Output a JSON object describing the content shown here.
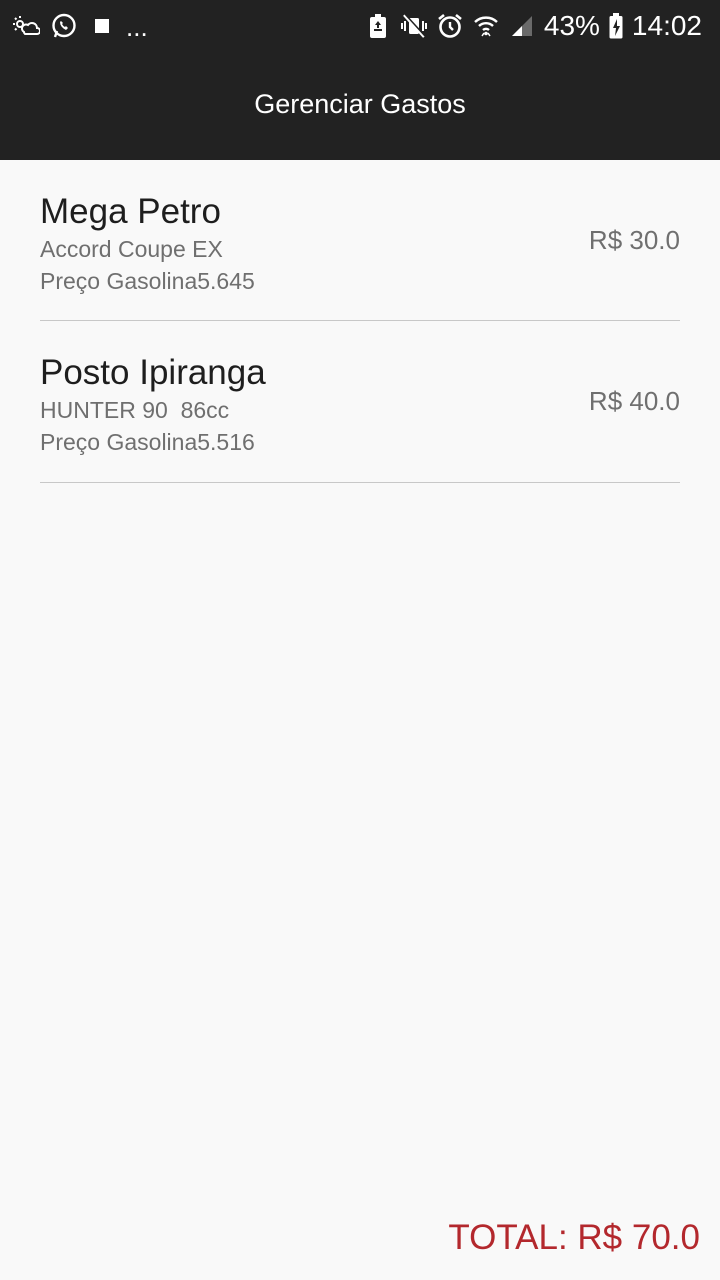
{
  "status_bar": {
    "left_icons": [
      "weather-icon",
      "whatsapp-icon",
      "stop-square-icon"
    ],
    "overflow": "...",
    "right_icons": [
      "battery-saver-icon",
      "vibrate-mute-icon",
      "alarm-icon",
      "wifi-icon",
      "signal-icon"
    ],
    "battery_percent": "43%",
    "time": "14:02"
  },
  "app_bar": {
    "title": "Gerenciar Gastos"
  },
  "expenses": [
    {
      "station": "Mega Petro",
      "vehicle": "Accord Coupe EX",
      "fuel_price": "Preço Gasolina5.645",
      "amount": "R$ 30.0"
    },
    {
      "station": "Posto Ipiranga",
      "vehicle": "HUNTER 90  86cc",
      "fuel_price": "Preço Gasolina5.516",
      "amount": "R$ 40.0"
    }
  ],
  "footer": {
    "total": "TOTAL: R$ 70.0"
  },
  "colors": {
    "bar": "#222222",
    "background": "#f9f9f9",
    "total": "#b3282d",
    "secondary_text": "#6f6f6f"
  }
}
